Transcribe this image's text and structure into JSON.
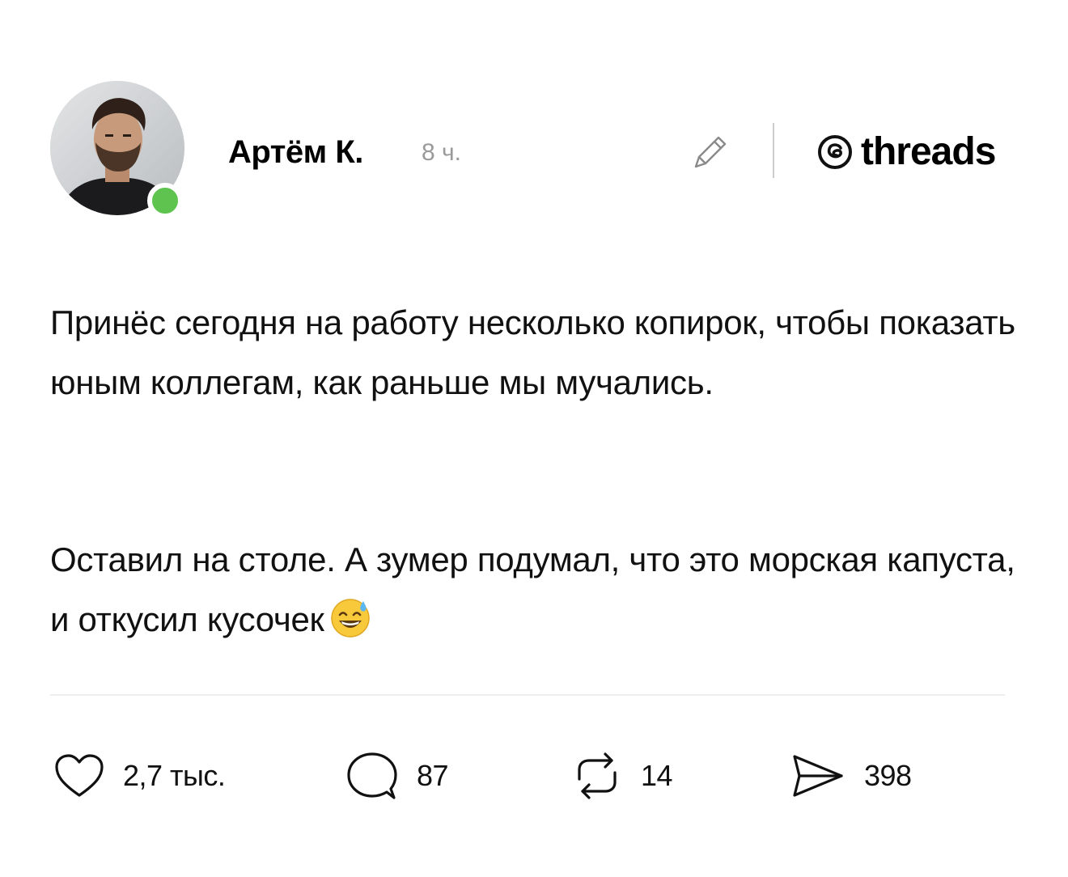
{
  "author": {
    "name": "Артём К.",
    "time": "8 ч.",
    "online": true
  },
  "brand": {
    "wordmark": "threads"
  },
  "post": {
    "paragraphs": [
      "Принёс сегодня на работу несколько копирок, чтобы показать юным коллегам, как раньше мы мучались.",
      "Оставил на столе. А зумер подумал, что это морская капуста, и откусил кусочек"
    ],
    "emoji": "grinning-face-with-sweat"
  },
  "actions": {
    "likes": "2,7 тыс.",
    "replies": "87",
    "reposts": "14",
    "shares": "398"
  },
  "colors": {
    "online_dot": "#5ec44f",
    "muted_text": "#9a9a9a"
  }
}
